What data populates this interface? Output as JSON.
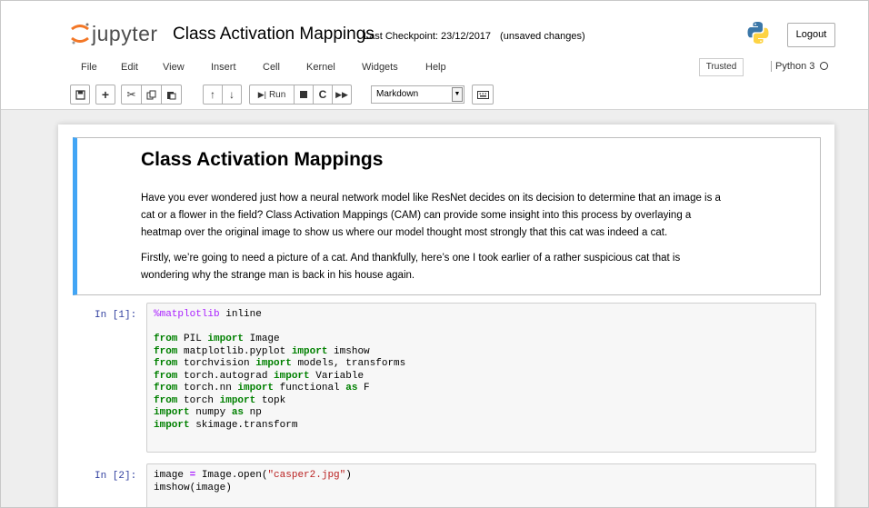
{
  "header": {
    "logo_text": "jupyter",
    "notebook_title": "Class Activation Mappings",
    "checkpoint": "Last Checkpoint: 23/12/2017",
    "unsaved": "(unsaved changes)",
    "logout_label": "Logout"
  },
  "menu": {
    "items": [
      "File",
      "Edit",
      "View",
      "Insert",
      "Cell",
      "Kernel",
      "Widgets",
      "Help"
    ],
    "trusted": "Trusted",
    "kernel_name": "Python 3"
  },
  "toolbar": {
    "run_label": "Run",
    "cell_type": "Markdown"
  },
  "markdown_cell": {
    "heading": "Class Activation Mappings",
    "para1_line1": "Have you ever wondered just how a neural network model like ResNet decides on its decision to determine that an image is a",
    "para1_line2": "cat or a flower in the field? Class Activation Mappings (CAM) can provide some insight into this process by overlaying a",
    "para1_line3": "heatmap over the original image to show us where our model thought most strongly that this cat was indeed a cat.",
    "para2_line1": "Firstly, we’re going to need a picture of a cat. And thankfully, here’s one I took earlier of a rather suspicious cat that is",
    "para2_line2": "wondering why the strange man is back in his house again."
  },
  "code_cells": [
    {
      "prompt": "In [1]:",
      "lines": [
        "%matplotlib inline",
        "",
        "from PIL import Image",
        "from matplotlib.pyplot import imshow",
        "from torchvision import models, transforms",
        "from torch.autograd import Variable",
        "from torch.nn import functional as F",
        "from torch import topk",
        "import numpy as np",
        "import skimage.transform"
      ]
    },
    {
      "prompt": "In [2]:",
      "lines": [
        "image = Image.open(\"casper2.jpg\")",
        "imshow(image)"
      ]
    }
  ],
  "colors": {
    "cell_selected_border": "#42a5f5",
    "prompt": "#303f9f",
    "keyword": "#008000",
    "string": "#ba2121",
    "magic": "#aa22ff"
  }
}
